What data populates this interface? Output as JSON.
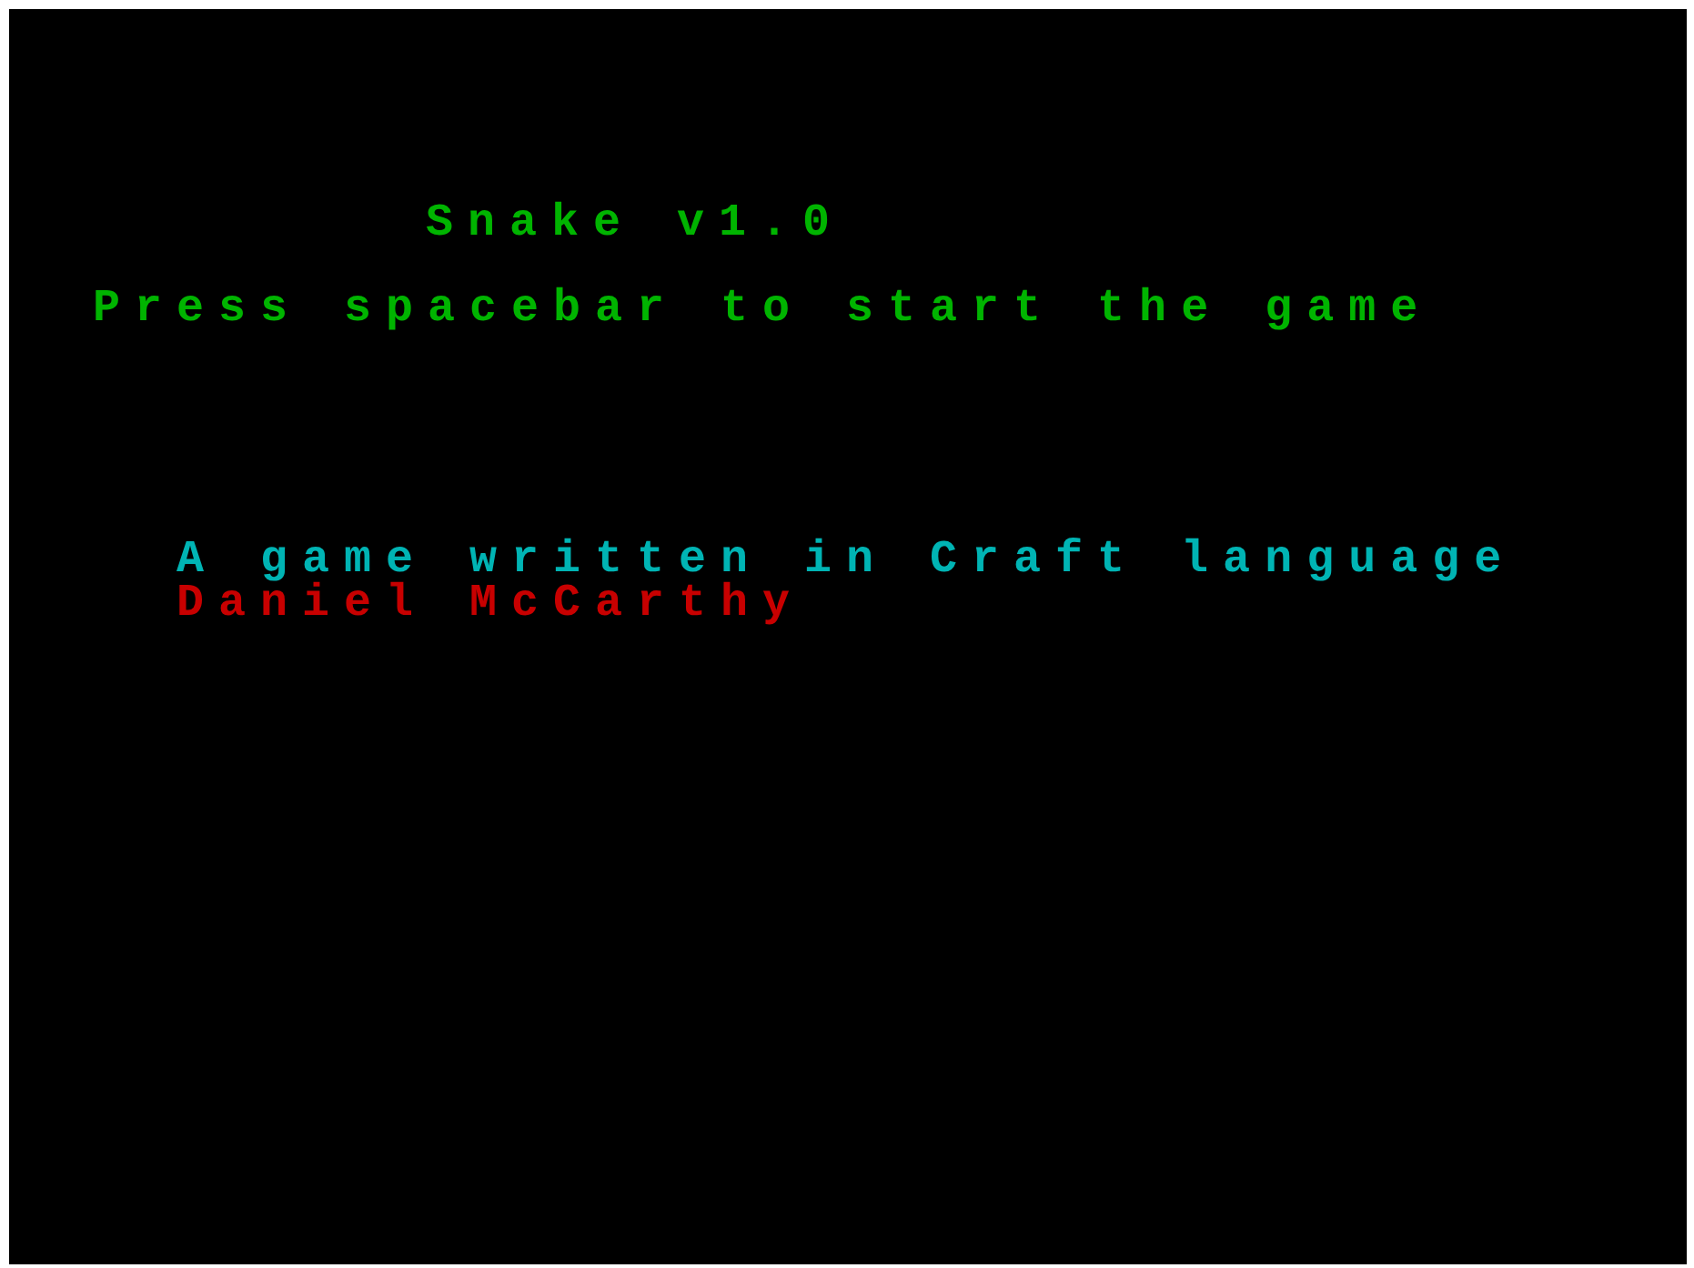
{
  "title": "Snake v1.0",
  "prompt": "Press spacebar to start the game",
  "credit": "A game written in Craft language",
  "author": "Daniel McCarthy"
}
